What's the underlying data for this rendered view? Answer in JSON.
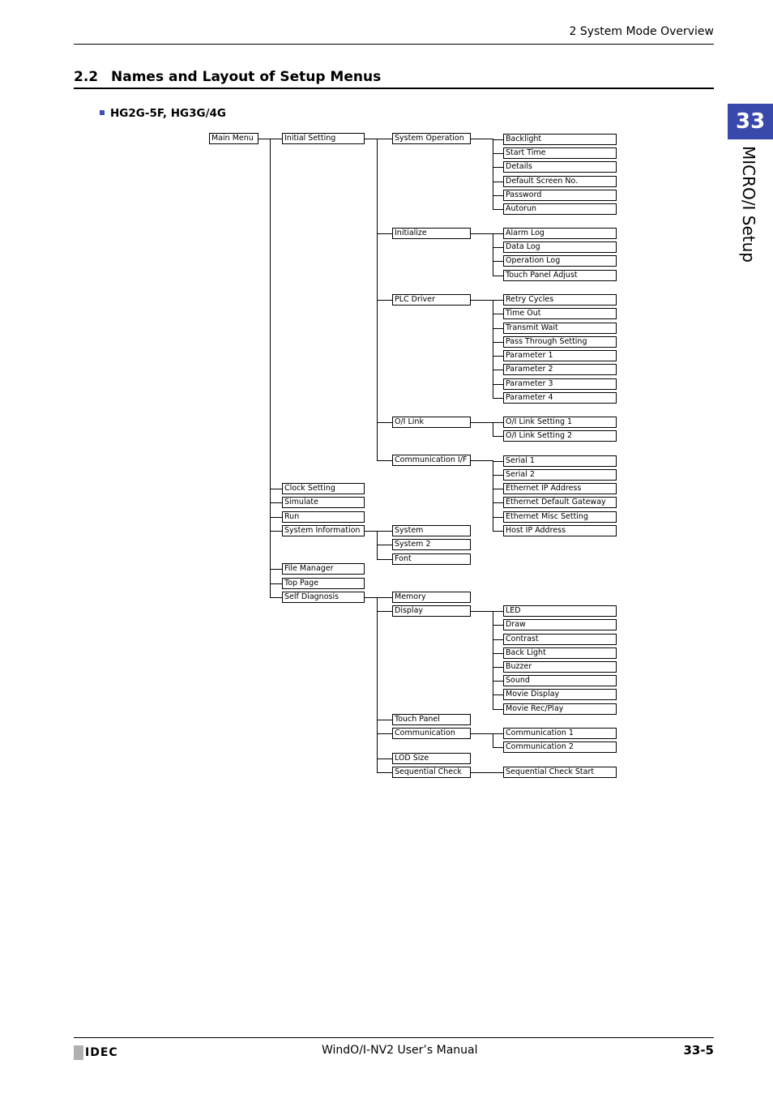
{
  "header": {
    "running_title": "2 System Mode Overview"
  },
  "section": {
    "number": "2.2",
    "title": "Names and Layout of Setup Menus"
  },
  "subheading": {
    "label": "HG2G-5F, HG3G/4G",
    "bullet_color": "#3f51b5"
  },
  "chapter_tab": {
    "number": "33",
    "label": "MICRO/I Setup",
    "color": "#3949ab"
  },
  "tree": {
    "label": "Main Menu",
    "children": [
      {
        "label": "Initial Setting",
        "children": [
          {
            "label": "System Operation",
            "children": [
              {
                "label": "Backlight"
              },
              {
                "label": "Start Time"
              },
              {
                "label": "Details"
              },
              {
                "label": "Default Screen No."
              },
              {
                "label": "Password"
              },
              {
                "label": "Autorun"
              }
            ]
          },
          {
            "label": "Initialize",
            "children": [
              {
                "label": "Alarm Log"
              },
              {
                "label": "Data Log"
              },
              {
                "label": "Operation Log"
              },
              {
                "label": "Touch Panel Adjust"
              }
            ]
          },
          {
            "label": "PLC Driver",
            "children": [
              {
                "label": "Retry Cycles"
              },
              {
                "label": "Time Out"
              },
              {
                "label": "Transmit Wait"
              },
              {
                "label": "Pass Through Setting"
              },
              {
                "label": "Parameter 1"
              },
              {
                "label": "Parameter 2"
              },
              {
                "label": "Parameter 3"
              },
              {
                "label": "Parameter 4"
              }
            ]
          },
          {
            "label": "O/I Link",
            "children": [
              {
                "label": "O/I Link Setting 1"
              },
              {
                "label": "O/I Link Setting 2"
              }
            ]
          },
          {
            "label": "Communication I/F",
            "children": [
              {
                "label": "Serial 1"
              },
              {
                "label": "Serial 2"
              },
              {
                "label": "Ethernet IP Address"
              },
              {
                "label": "Ethernet Default Gateway"
              },
              {
                "label": "Ethernet Misc Setting"
              },
              {
                "label": "Host IP Address"
              }
            ]
          }
        ]
      },
      {
        "label": "Clock Setting"
      },
      {
        "label": "Simulate"
      },
      {
        "label": "Run"
      },
      {
        "label": "System Information",
        "children": [
          {
            "label": "System"
          },
          {
            "label": "System 2"
          },
          {
            "label": "Font"
          }
        ]
      },
      {
        "label": "File Manager"
      },
      {
        "label": "Top Page"
      },
      {
        "label": "Self Diagnosis",
        "children": [
          {
            "label": "Memory"
          },
          {
            "label": "Display",
            "children": [
              {
                "label": "LED"
              },
              {
                "label": "Draw"
              },
              {
                "label": "Contrast"
              },
              {
                "label": "Back Light"
              },
              {
                "label": "Buzzer"
              },
              {
                "label": "Sound"
              },
              {
                "label": "Movie Display"
              },
              {
                "label": "Movie Rec/Play"
              }
            ]
          },
          {
            "label": "Touch Panel"
          },
          {
            "label": "Communication",
            "children": [
              {
                "label": "Communication 1"
              },
              {
                "label": "Communication 2"
              }
            ]
          },
          {
            "label": "LOD Size"
          },
          {
            "label": "Sequential Check",
            "children": [
              {
                "label": "Sequential Check Start"
              }
            ]
          }
        ]
      }
    ]
  },
  "footer": {
    "logo": "IDEC",
    "manual_title": "WindO/I-NV2 User’s Manual",
    "page_number": "33-5"
  }
}
